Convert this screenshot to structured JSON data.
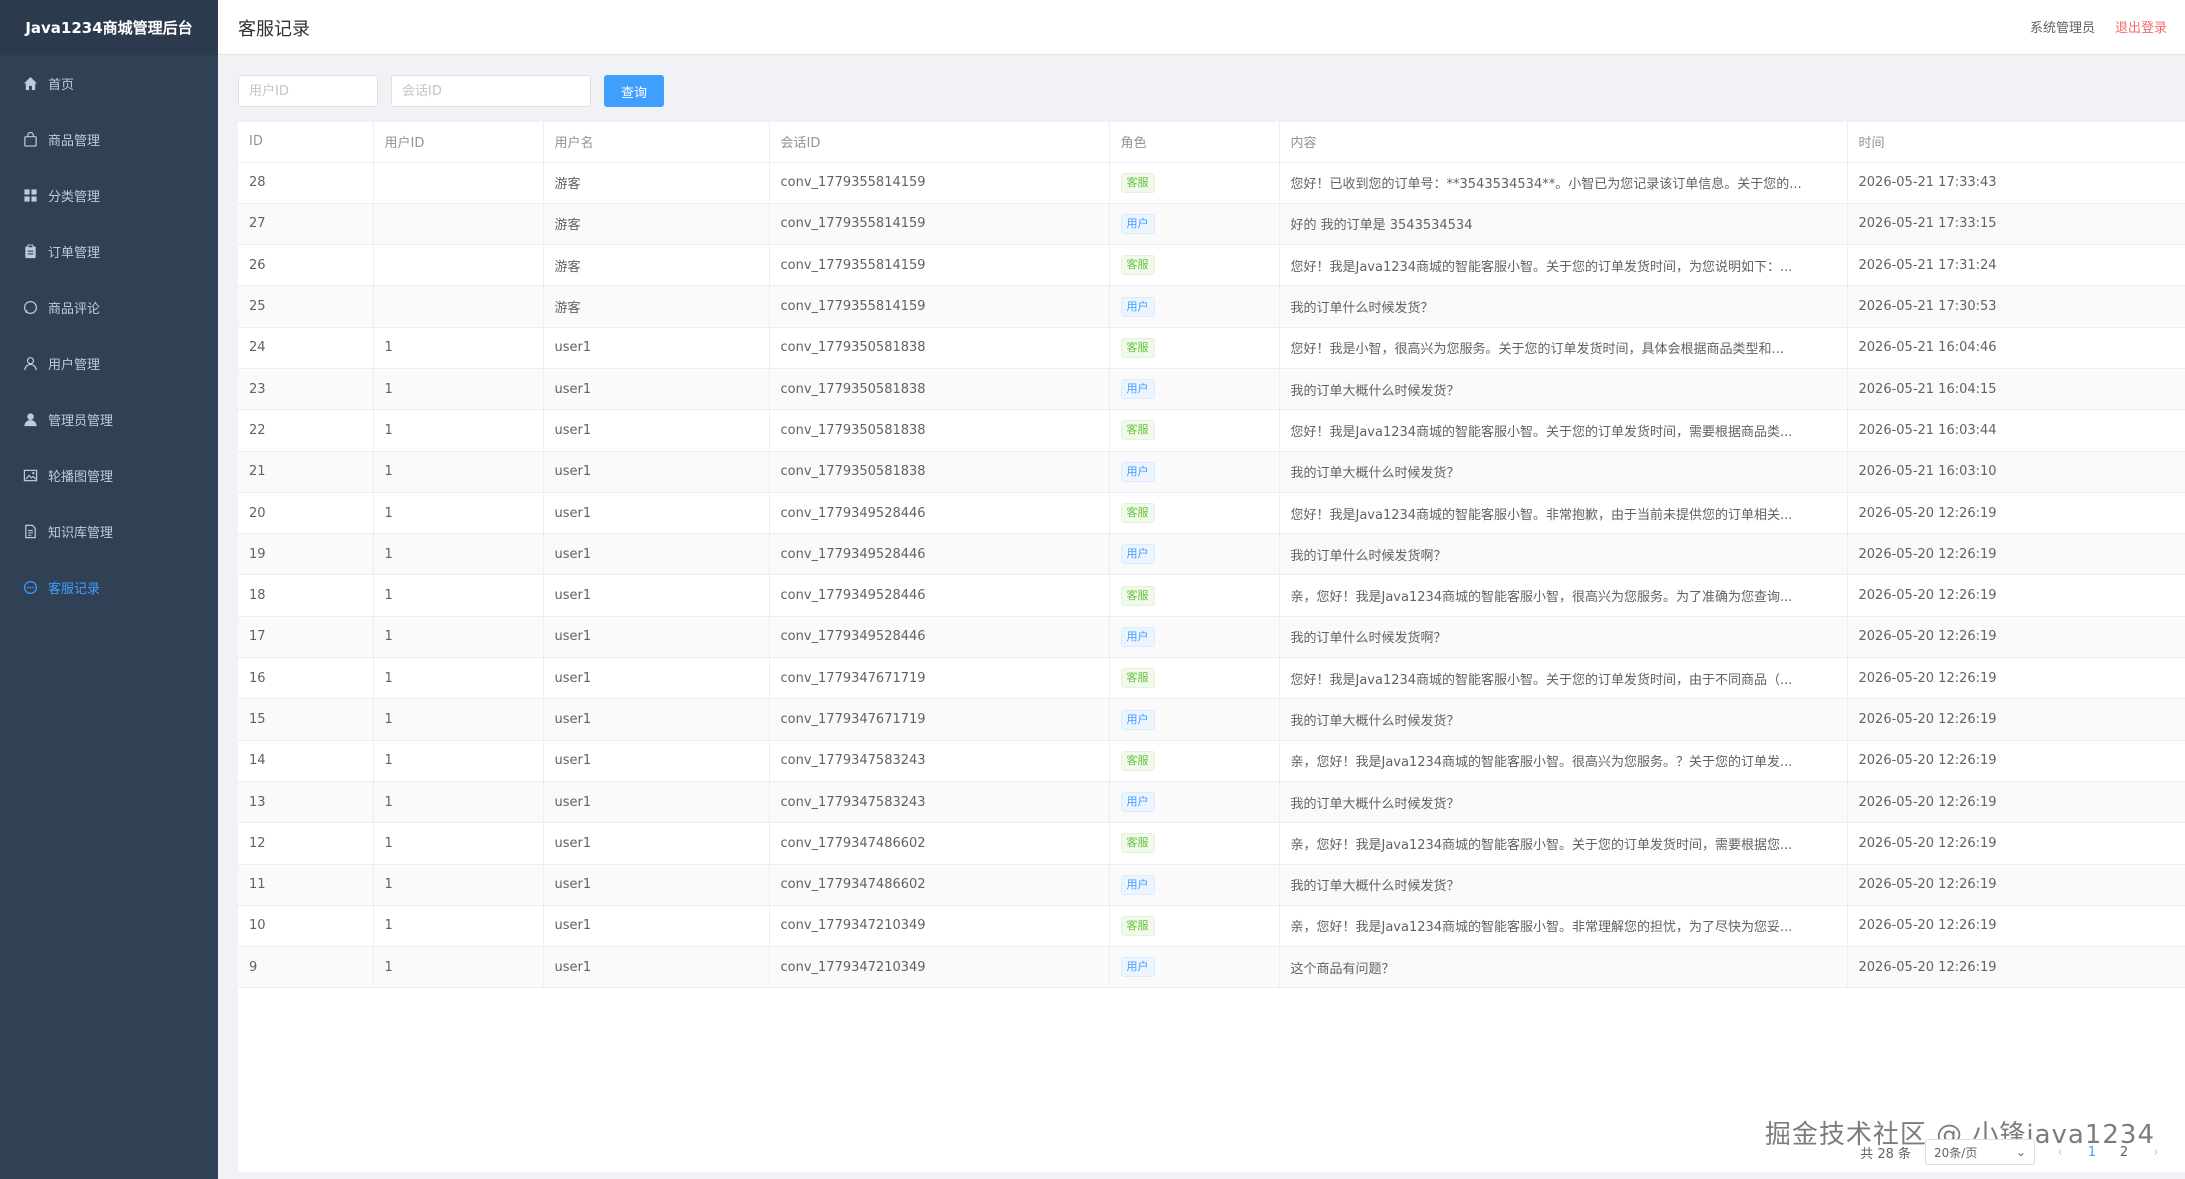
{
  "app": {
    "brand": "Java1234商城管理后台"
  },
  "sidebar": {
    "items": [
      {
        "label": "首页",
        "icon": "home-icon"
      },
      {
        "label": "商品管理",
        "icon": "bag-icon"
      },
      {
        "label": "分类管理",
        "icon": "grid-icon"
      },
      {
        "label": "订单管理",
        "icon": "clipboard-icon"
      },
      {
        "label": "商品评论",
        "icon": "chat-icon"
      },
      {
        "label": "用户管理",
        "icon": "user-icon"
      },
      {
        "label": "管理员管理",
        "icon": "user-solid-icon"
      },
      {
        "label": "轮播图管理",
        "icon": "picture-icon"
      },
      {
        "label": "知识库管理",
        "icon": "document-icon"
      },
      {
        "label": "客服记录",
        "icon": "chat-dots-icon",
        "active": true
      }
    ]
  },
  "header": {
    "title": "客服记录",
    "admin": "系统管理员",
    "logout": "退出登录"
  },
  "filters": {
    "user_id_placeholder": "用户ID",
    "conv_id_placeholder": "会话ID",
    "query_label": "查询"
  },
  "table": {
    "columns": [
      "ID",
      "用户ID",
      "用户名",
      "会话ID",
      "角色",
      "内容",
      "时间"
    ],
    "rows": [
      [
        "28",
        "",
        "游客",
        "conv_1779355814159",
        "客服",
        "您好！已收到您的订单号：**3543534534**。小智已为您记录该订单信息。关于您的...",
        "2026-05-21 17:33:43"
      ],
      [
        "27",
        "",
        "游客",
        "conv_1779355814159",
        "用户",
        "好的 我的订单是 3543534534",
        "2026-05-21 17:33:15"
      ],
      [
        "26",
        "",
        "游客",
        "conv_1779355814159",
        "客服",
        "您好！我是Java1234商城的智能客服小智。关于您的订单发货时间，为您说明如下：...",
        "2026-05-21 17:31:24"
      ],
      [
        "25",
        "",
        "游客",
        "conv_1779355814159",
        "用户",
        "我的订单什么时候发货？",
        "2026-05-21 17:30:53"
      ],
      [
        "24",
        "1",
        "user1",
        "conv_1779350581838",
        "客服",
        "您好！我是小智，很高兴为您服务。关于您的订单发货时间，具体会根据商品类型和...",
        "2026-05-21 16:04:46"
      ],
      [
        "23",
        "1",
        "user1",
        "conv_1779350581838",
        "用户",
        "我的订单大概什么时候发货？",
        "2026-05-21 16:04:15"
      ],
      [
        "22",
        "1",
        "user1",
        "conv_1779350581838",
        "客服",
        "您好！我是Java1234商城的智能客服小智。关于您的订单发货时间，需要根据商品类...",
        "2026-05-21 16:03:44"
      ],
      [
        "21",
        "1",
        "user1",
        "conv_1779350581838",
        "用户",
        "我的订单大概什么时候发货？",
        "2026-05-21 16:03:10"
      ],
      [
        "20",
        "1",
        "user1",
        "conv_1779349528446",
        "客服",
        "您好！我是Java1234商城的智能客服小智。非常抱歉，由于当前未提供您的订单相关...",
        "2026-05-20 12:26:19"
      ],
      [
        "19",
        "1",
        "user1",
        "conv_1779349528446",
        "用户",
        "我的订单什么时候发货啊？",
        "2026-05-20 12:26:19"
      ],
      [
        "18",
        "1",
        "user1",
        "conv_1779349528446",
        "客服",
        "亲，您好！我是Java1234商城的智能客服小智，很高兴为您服务。为了准确为您查询...",
        "2026-05-20 12:26:19"
      ],
      [
        "17",
        "1",
        "user1",
        "conv_1779349528446",
        "用户",
        "我的订单什么时候发货啊？",
        "2026-05-20 12:26:19"
      ],
      [
        "16",
        "1",
        "user1",
        "conv_1779347671719",
        "客服",
        "您好！我是Java1234商城的智能客服小智。关于您的订单发货时间，由于不同商品（...",
        "2026-05-20 12:26:19"
      ],
      [
        "15",
        "1",
        "user1",
        "conv_1779347671719",
        "用户",
        "我的订单大概什么时候发货？",
        "2026-05-20 12:26:19"
      ],
      [
        "14",
        "1",
        "user1",
        "conv_1779347583243",
        "客服",
        "亲，您好！我是Java1234商城的智能客服小智。很高兴为您服务。？关于您的订单发...",
        "2026-05-20 12:26:19"
      ],
      [
        "13",
        "1",
        "user1",
        "conv_1779347583243",
        "用户",
        "我的订单大概什么时候发货？",
        "2026-05-20 12:26:19"
      ],
      [
        "12",
        "1",
        "user1",
        "conv_1779347486602",
        "客服",
        "亲，您好！我是Java1234商城的智能客服小智。关于您的订单发货时间，需要根据您...",
        "2026-05-20 12:26:19"
      ],
      [
        "11",
        "1",
        "user1",
        "conv_1779347486602",
        "用户",
        "我的订单大概什么时候发货？",
        "2026-05-20 12:26:19"
      ],
      [
        "10",
        "1",
        "user1",
        "conv_1779347210349",
        "客服",
        "亲，您好！我是Java1234商城的智能客服小智。非常理解您的担忧，为了尽快为您妥...",
        "2026-05-20 12:26:19"
      ],
      [
        "9",
        "1",
        "user1",
        "conv_1779347210349",
        "用户",
        "这个商品有问题？",
        "2026-05-20 12:26:19"
      ]
    ]
  },
  "pagination": {
    "total": "共 28 条",
    "page_size": "20条/页",
    "pages": [
      "1",
      "2"
    ],
    "current": "1"
  },
  "watermark": "掘金技术社区 @ 小锋java1234",
  "colors": {
    "sidebar_bg": "#304156",
    "accent": "#409eff",
    "logout": "#f56c6c",
    "tag_cs": "#67c23a",
    "tag_user": "#409eff"
  }
}
